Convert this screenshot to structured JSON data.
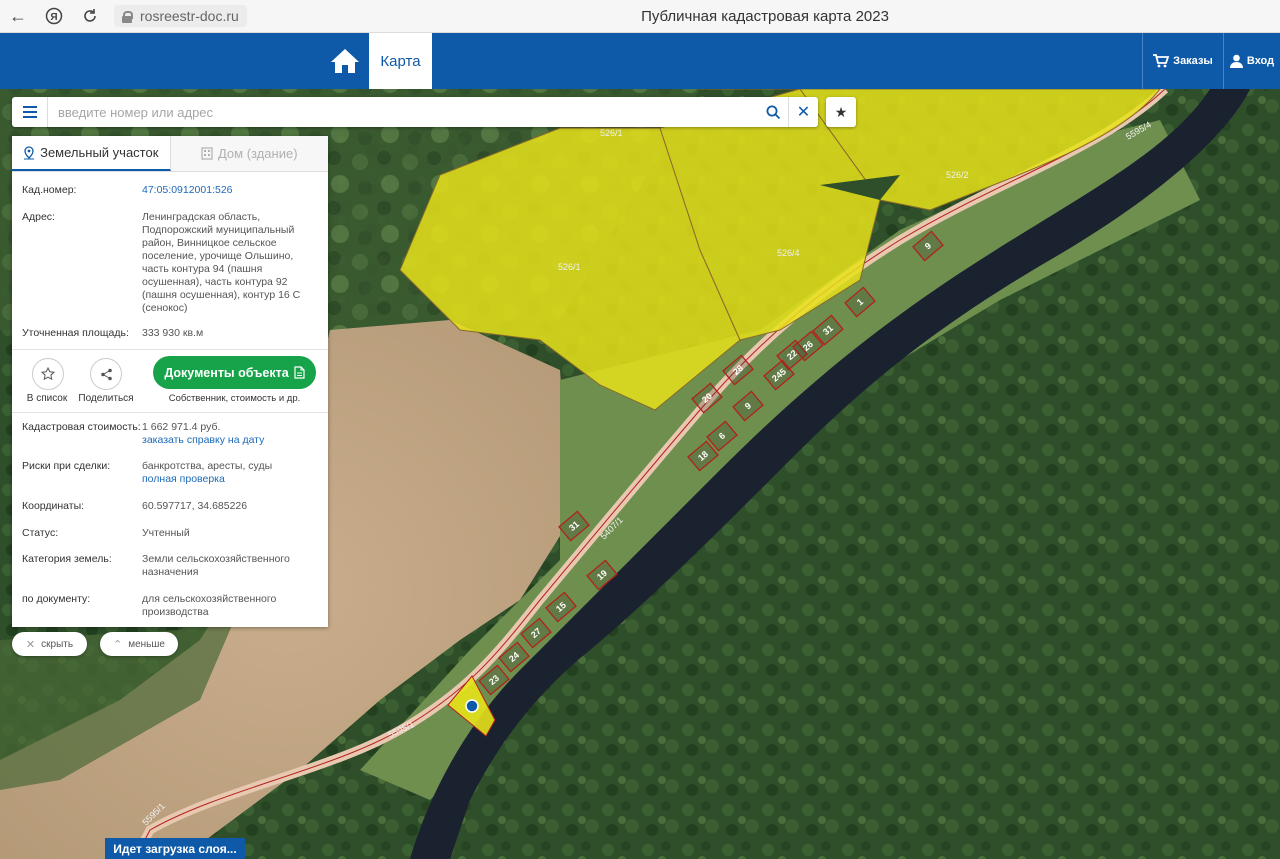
{
  "browser": {
    "url": "rosreestr-doc.ru",
    "page_title": "Публичная кадастровая карта 2023"
  },
  "header": {
    "tab_label": "Карта",
    "orders_label": "Заказы",
    "login_label": "Вход"
  },
  "search": {
    "placeholder": "введите номер или адрес"
  },
  "panel": {
    "tab_land": "Земельный участок",
    "tab_house": "Дом (здание)",
    "cad_number_label": "Кад.номер:",
    "cad_number": "47:05:0912001:526",
    "address_label": "Адрес:",
    "address": "Ленинградская область, Подпорожский муниципальный район, Винницкое сельское поселение, урочище Ольшино, часть контура 94 (пашня осушенная), часть контура 92 (пашня осушенная), контур 16 С (сенокос)",
    "area_label": "Уточненная площадь:",
    "area": "333 930 кв.м",
    "to_list_label": "В список",
    "share_label": "Поделиться",
    "docs_button": "Документы объекта",
    "docs_sub": "Собственник, стоимость и др.",
    "cost_label": "Кадастровая стоимость:",
    "cost": "1 662 971.4 руб.",
    "cost_link": "заказать справку на дату",
    "risks_label": "Риски при сделки:",
    "risks": "банкротства, аресты, суды",
    "risks_link": "полная проверка",
    "coords_label": "Координаты:",
    "coords": "60.597717, 34.685226",
    "status_label": "Статус:",
    "status": "Учтенный",
    "category_label": "Категория земель:",
    "category": "Земли сельскохозяйственного назначения",
    "by_doc_label": "по документу:",
    "by_doc": "для сельскохозяйственного производства"
  },
  "controls": {
    "hide_label": "скрыть",
    "less_label": "меньше"
  },
  "map": {
    "loading": "Идет загрузка слоя...",
    "parcel_labels": {
      "p5261": "526/1",
      "p5261b": "526/1",
      "p5264": "526/4",
      "p5262": "526/2",
      "road1": "5595/4",
      "road2": "5407/1",
      "road3": "5595/1",
      "road4": "5595/1"
    },
    "lot_numbers": [
      "9",
      "1",
      "31",
      "22",
      "26",
      "245",
      "28",
      "20",
      "9",
      "6",
      "18",
      "31",
      "19",
      "15",
      "27",
      "24",
      "23"
    ],
    "colors": {
      "parcel_fill": "#e6e21a",
      "parcel_border": "#b3211c",
      "road": "#e8c8b0",
      "river": "#1a2230"
    }
  }
}
